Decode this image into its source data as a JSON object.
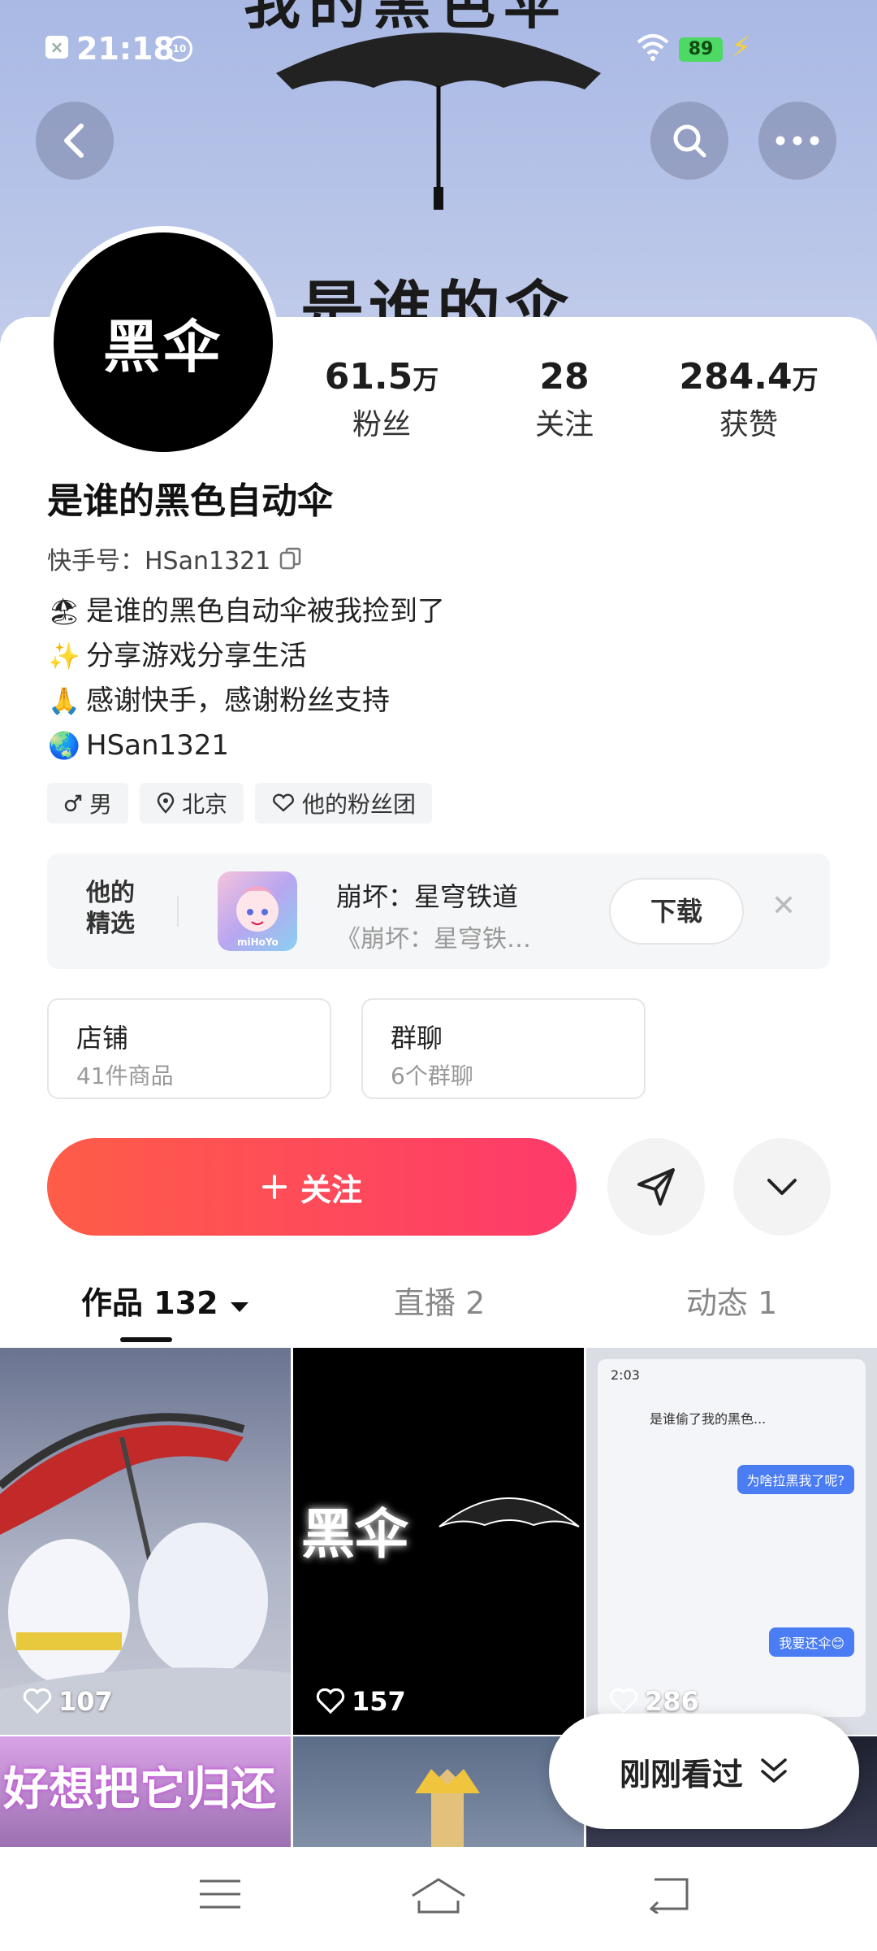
{
  "status_bar": {
    "time": "21:18",
    "hd_badge": "10",
    "battery": "89"
  },
  "cover": {
    "banner_text": "是谁的伞",
    "top_text": "我的黑色伞"
  },
  "header": {
    "back_icon": "back-arrow-icon",
    "search_icon": "search-icon",
    "more_icon": "more-dots-icon"
  },
  "profile": {
    "avatar_text": "黑伞",
    "name": "是谁的黑色自动伞",
    "kuaishou_id_label": "快手号：",
    "kuaishou_id": "HSan1321",
    "stats": [
      {
        "num": "61.5",
        "unit": "万",
        "label": "粉丝"
      },
      {
        "num": "28",
        "unit": "",
        "label": "关注"
      },
      {
        "num": "284.4",
        "unit": "万",
        "label": "获赞"
      }
    ],
    "bio": [
      {
        "emoji": "🏖",
        "text": "是谁的黑色自动伞被我捡到了"
      },
      {
        "emoji": "✨",
        "text": "分享游戏分享生活"
      },
      {
        "emoji": "🙏",
        "text": "感谢快手，感谢粉丝支持"
      },
      {
        "emoji": "🌏",
        "text": "HSan1321"
      }
    ],
    "tags": [
      {
        "icon": "male-icon",
        "text": "男"
      },
      {
        "icon": "location-pin-icon",
        "text": "北京"
      },
      {
        "icon": "fan-group-icon",
        "text": "他的粉丝团"
      }
    ]
  },
  "featured": {
    "title": "他的\n精选",
    "title_line1": "他的",
    "title_line2": "精选",
    "game_name": "崩坏：星穹铁道",
    "game_sub": "《崩坏：星穹铁…",
    "game_brand": "miHoYo",
    "download_label": "下载"
  },
  "boxes": [
    {
      "title": "店铺",
      "sub": "41件商品"
    },
    {
      "title": "群聊",
      "sub": "6个群聊"
    }
  ],
  "actions": {
    "follow_label": "关注"
  },
  "tabs": [
    {
      "label": "作品 132"
    },
    {
      "label": "直播 2"
    },
    {
      "label": "动态 1"
    }
  ],
  "grid": {
    "items": [
      {
        "likes": "107"
      },
      {
        "likes": "157",
        "overlay": "黑伞"
      },
      {
        "likes": "286"
      },
      {
        "overlay": "好想把它归还"
      }
    ],
    "chat": {
      "time": "2:03",
      "title": "是谁偷了我的黑色...",
      "bubble1": "为啥拉黑我了呢?",
      "bubble2": "我要还伞😊"
    }
  },
  "recent": {
    "label": "刚刚看过"
  },
  "colors": {
    "follow_start": "#fe5d48",
    "follow_end": "#fe3a6a",
    "cover_bg": "#b6c3e8",
    "battery": "#4cd964"
  }
}
